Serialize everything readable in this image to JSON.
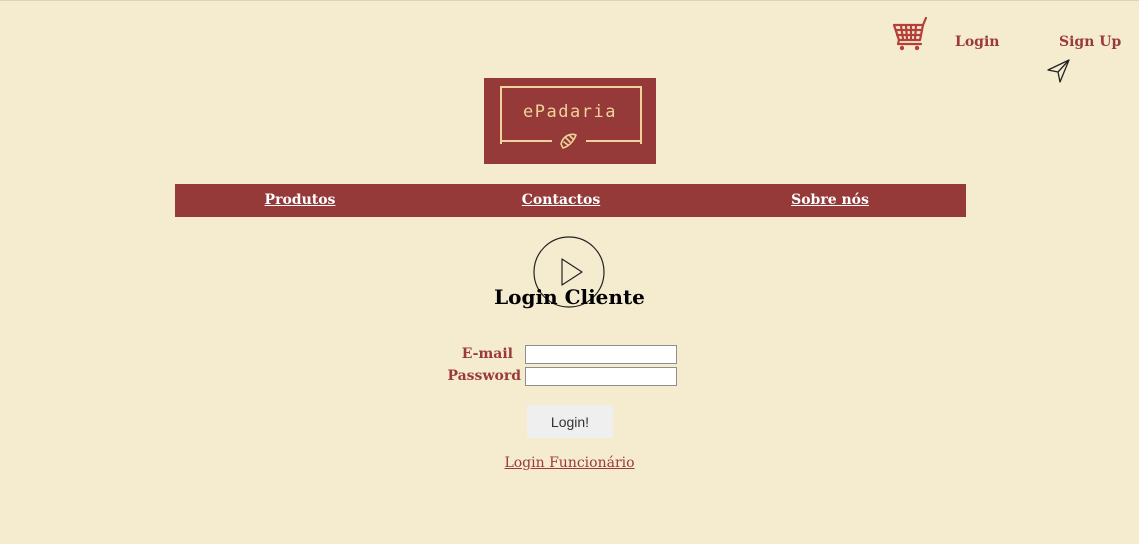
{
  "header": {
    "cart_icon": "shopping-cart-icon",
    "login_label": "Login",
    "signup_label": "Sign Up",
    "cursor_icon": "send-arrow-icon"
  },
  "logo": {
    "text": "ePadaria",
    "icon": "croissant-icon"
  },
  "nav": {
    "items": [
      {
        "label": "Produtos"
      },
      {
        "label": "Contactos"
      },
      {
        "label": "Sobre nós"
      }
    ]
  },
  "main": {
    "play_icon": "play-circle-icon",
    "title": "Login Cliente",
    "email_label": "E-mail",
    "email_value": "",
    "password_label": "Password",
    "password_value": "",
    "submit_label": "Login!",
    "worker_login_label": "Login Funcionário"
  },
  "colors": {
    "background": "#f5ebcf",
    "brand": "#953939",
    "accent_text": "#9a3a3a",
    "logo_gold": "#f0d39a"
  }
}
